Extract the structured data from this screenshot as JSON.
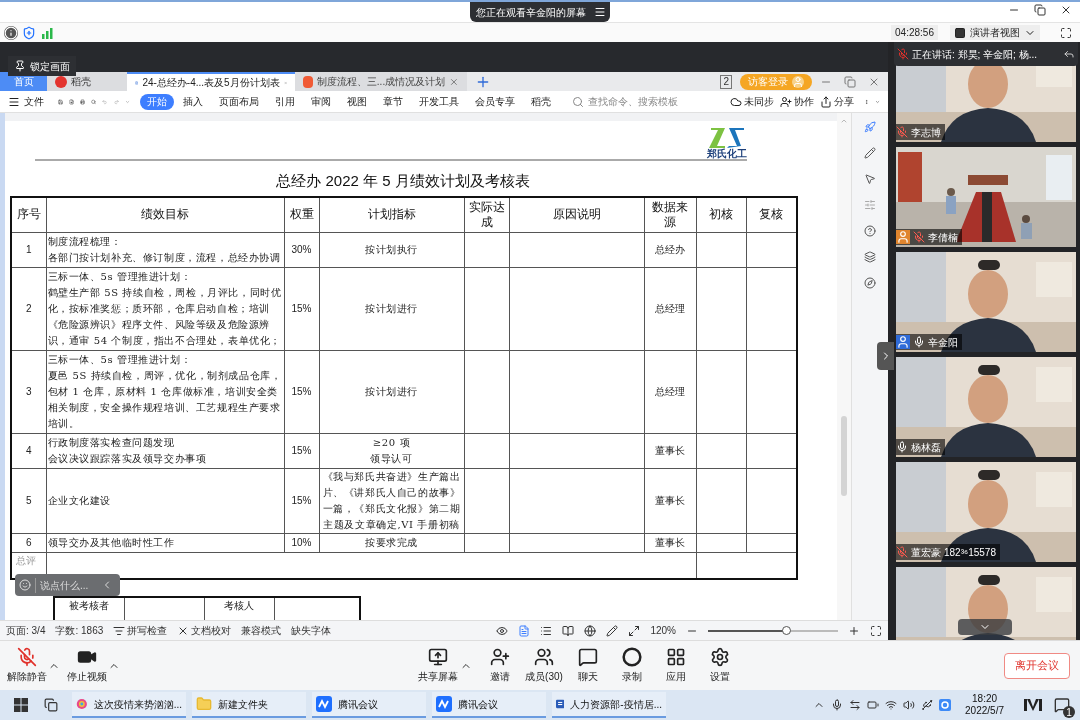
{
  "share_banner": {
    "text": "您正在观看辛金阳的屏幕"
  },
  "meeting_info": {
    "timer": "04:28:56",
    "view_button": "演讲者视图"
  },
  "lock_tooltip": {
    "text": "锁定画面"
  },
  "speaking_bar": {
    "text": "正在讲话: 郑昊; 辛金阳; 杨...",
    "muted": true
  },
  "wps": {
    "tabs": [
      {
        "label": "首页",
        "kind": "home",
        "selected": false
      },
      {
        "label": "稻壳",
        "kind": "store",
        "selected": false
      },
      {
        "label": "24-总经办-4...表及5月份计划表",
        "kind": "writer",
        "selected": true
      },
      {
        "label": "制度流程、三...成情况及计划",
        "kind": "pdf",
        "selected": false
      }
    ],
    "window_count": "2",
    "login_button": "访客登录",
    "file_menu": "文件",
    "ribbon_tabs": [
      {
        "label": "开始",
        "selected": true
      },
      {
        "label": "插入",
        "selected": false
      },
      {
        "label": "页面布局",
        "selected": false
      },
      {
        "label": "引用",
        "selected": false
      },
      {
        "label": "审阅",
        "selected": false
      },
      {
        "label": "视图",
        "selected": false
      },
      {
        "label": "章节",
        "selected": false
      },
      {
        "label": "开发工具",
        "selected": false
      },
      {
        "label": "会员专享",
        "selected": false
      },
      {
        "label": "稻壳",
        "selected": false
      }
    ],
    "search": {
      "placeholder": "查找命令、搜索模板"
    },
    "actions": [
      {
        "label": "未同步",
        "kind": "sync"
      },
      {
        "label": "协作",
        "kind": "collab"
      },
      {
        "label": "分享",
        "kind": "share"
      }
    ]
  },
  "document": {
    "logo_caption": "郑氏化工",
    "title": "总经办 2022 年 5 月绩效计划及考核表",
    "table": {
      "columns": [
        "序号",
        "绩效目标",
        "权重",
        "计划指标",
        "实际达成",
        "原因说明",
        "数据来源",
        "初核",
        "复核"
      ],
      "rows": [
        {
          "no": "1",
          "goal": [
            "制度流程梳理：",
            "各部门按计划补充、修订制度，流程，总经办协调"
          ],
          "weight": "30%",
          "plan": [
            "按计划执行"
          ],
          "source": "总经办"
        },
        {
          "no": "2",
          "goal": [
            "三标一体、5s 管理推进计划：",
            "鹤壁生产部 5S 持续自检，周检，月评比，同时优化，按标准奖惩；质环部，仓库启动自检；培训《危险源辨识》程序文件、风险等级及危险源辨识，通审 54 个制度，指出不合理处，表单优化；"
          ],
          "weight": "15%",
          "plan": [
            "按计划进行"
          ],
          "source": "总经理"
        },
        {
          "no": "3",
          "goal": [
            "三标一体、5s 管理推进计划：",
            "夏邑 5S 持续自检，周评，优化，制剂成品仓库，包材 1 仓库，原材料 1 仓库做标准，培训安全类相关制度，安全操作规程培训、工艺规程生产要求培训。"
          ],
          "weight": "15%",
          "plan": [
            "按计划进行"
          ],
          "source": "总经理"
        },
        {
          "no": "4",
          "goal": [
            "行政制度落实检查问题发现",
            "会议决议跟踪落实及领导交办事项"
          ],
          "weight": "15%",
          "plan": [
            "≥20 项",
            "领导认可"
          ],
          "source": "董事长"
        },
        {
          "no": "5",
          "goal": [
            "企业文化建设"
          ],
          "weight": "15%",
          "plan": [
            "《我与郑氏共奋进》生产篇出片、《讲郑氏人自己的故事》一篇，《郑氏文化报》第二期主题及文章确定,VI 手册初稿"
          ],
          "source": "董事长"
        },
        {
          "no": "6",
          "goal": [
            "领导交办及其他临时性工作"
          ],
          "weight": "10%",
          "plan": [
            "按要求完成"
          ],
          "source": "董事长"
        }
      ],
      "summary_label": "总评"
    },
    "sign_table": [
      "被考核者",
      "考核人"
    ]
  },
  "chat_input": {
    "placeholder": "说点什么..."
  },
  "status_bar": {
    "page": "页面: 3/4",
    "words": "字数: 1863",
    "spell": "拼写检查",
    "proof": "文档校对",
    "compat": "兼容模式",
    "fonts": "缺失字体",
    "zoom": "120%",
    "zoom_slider": {
      "level": 0.6
    }
  },
  "participants": [
    {
      "name": "李志博",
      "muted": true,
      "kind": "person"
    },
    {
      "name": "李倩楠",
      "muted": true,
      "kind": "room",
      "color": "#e0852e"
    },
    {
      "name": "辛金阳",
      "muted": false,
      "kind": "person",
      "color": "#2f6bd8"
    },
    {
      "name": "杨林磊",
      "muted": false,
      "kind": "person"
    },
    {
      "name": "董宏豪",
      "note": "182³⁶15578",
      "muted": true,
      "kind": "person"
    },
    {
      "kind": "person"
    }
  ],
  "toolbar": [
    {
      "label": "解除静音",
      "kind": "mic",
      "muted": true
    },
    {
      "label": "停止视频",
      "kind": "video"
    },
    {
      "label": "共享屏幕",
      "kind": "share"
    },
    {
      "label": "邀请",
      "kind": "invite"
    },
    {
      "label": "成员(30)",
      "kind": "members"
    },
    {
      "label": "聊天",
      "kind": "chat"
    },
    {
      "label": "录制",
      "kind": "record"
    },
    {
      "label": "应用",
      "kind": "apps"
    },
    {
      "label": "设置",
      "kind": "settings"
    }
  ],
  "leave_button": "离开会议",
  "taskbar": {
    "apps": [
      {
        "label": "这次疫情来势汹汹...",
        "kind": "browser"
      },
      {
        "label": "新建文件夹",
        "kind": "folder"
      },
      {
        "label": "腾讯会议",
        "kind": "meeting"
      },
      {
        "label": "腾讯会议",
        "kind": "meeting"
      },
      {
        "label": "人力资源部-疫情居...",
        "kind": "word"
      }
    ],
    "time": "18:20",
    "date": "2022/5/7",
    "notifications": "1"
  }
}
